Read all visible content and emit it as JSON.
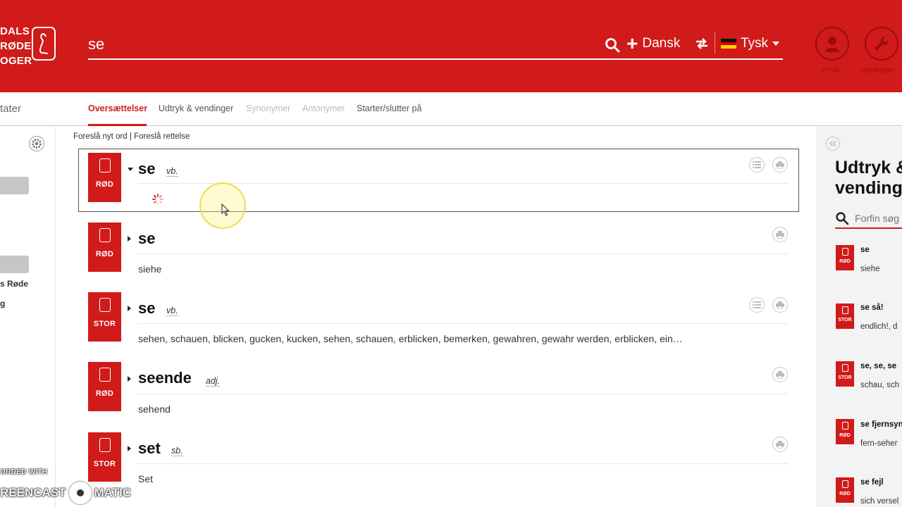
{
  "header": {
    "brand_lines": [
      "DALS",
      "RØDE",
      "OGER"
    ],
    "top_faint_text": "... .... ...... .......... ......  ....",
    "search": {
      "value": "se",
      "placeholder": ""
    },
    "lang_from": "Dansk",
    "lang_to": "Tysk",
    "profile_label": "Profil",
    "tools_label": "Værktøjer",
    "colors": {
      "brand_red": "#d11a1a"
    }
  },
  "tabs": {
    "left_partial": "tater",
    "items": [
      {
        "label": "Oversættelser",
        "state": "active"
      },
      {
        "label": "Udtryk & vendinger",
        "state": "normal"
      },
      {
        "label": "Synonymer",
        "state": "disabled"
      },
      {
        "label": "Antonymer",
        "state": "disabled"
      },
      {
        "label": "Starter/slutter på",
        "state": "normal"
      }
    ]
  },
  "left": {
    "text1": "s Røde",
    "text2": "g"
  },
  "suggest": {
    "new_word": "Foreslå nyt ord",
    "separator": "|",
    "correction": "Foreslå rettelse"
  },
  "entries": [
    {
      "badge": "RØD",
      "word": "se",
      "pos": "vb.",
      "translation": "",
      "expanded": true,
      "loading": true
    },
    {
      "badge": "RØD",
      "word": "se",
      "pos": "",
      "translation": "siehe",
      "expanded": false
    },
    {
      "badge": "STOR",
      "word": "se",
      "pos": "vb.",
      "translation": "sehen, schauen, blicken, gucken, kucken, sehen, schauen, erblicken, bemerken, gewahren, gewahr werden, erblicken, ein…",
      "expanded": false
    },
    {
      "badge": "RØD",
      "word": "seende",
      "pos": "adj.",
      "translation": "sehend",
      "expanded": false
    },
    {
      "badge": "STOR",
      "word": "set",
      "pos": "sb.",
      "translation": "Set",
      "expanded": false
    }
  ],
  "right_panel": {
    "title_line1": "Udtryk &",
    "title_line2": "vending",
    "search_placeholder": "Forfin søg",
    "items": [
      {
        "badge": "RØD",
        "head": "se",
        "trans": "siehe"
      },
      {
        "badge": "STOR",
        "head": "se så!",
        "trans": "endlich!, d"
      },
      {
        "badge": "STOR",
        "head": "se, se, se",
        "trans": "schau, sch"
      },
      {
        "badge": "RØD",
        "head": "se fjernsyn",
        "trans": "fern-seher"
      },
      {
        "badge": "RØD",
        "head": "se fejl",
        "trans": "sich versel"
      }
    ]
  },
  "watermark": {
    "line1": "ORDED WITH",
    "line2_left": "REENCAST",
    "line2_right": "MATIC"
  }
}
